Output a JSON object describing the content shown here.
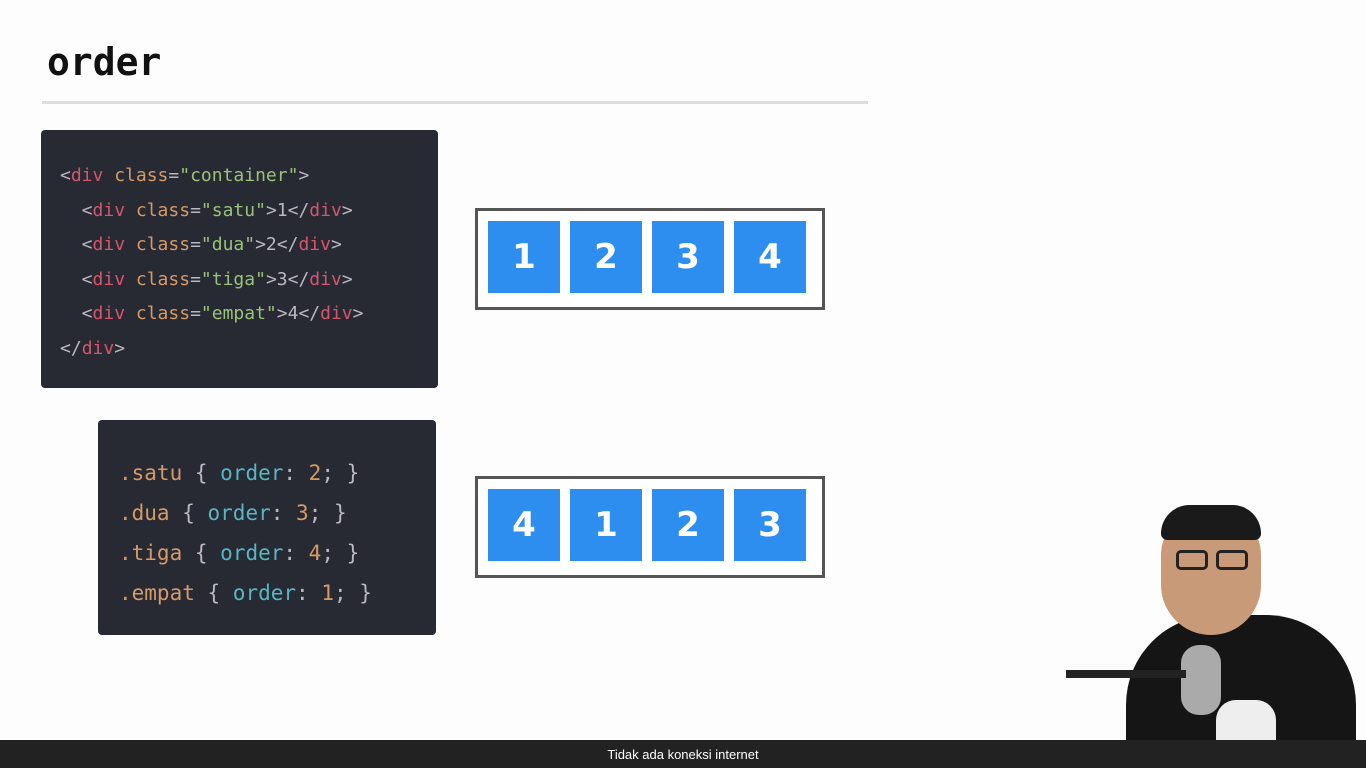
{
  "slide": {
    "title": "order",
    "html_code": [
      [
        {
          "t": "<",
          "c": "punct"
        },
        {
          "t": "div",
          "c": "tag"
        },
        {
          "t": " class",
          "c": "attr"
        },
        {
          "t": "=",
          "c": "punct"
        },
        {
          "t": "\"container\"",
          "c": "str"
        },
        {
          "t": ">",
          "c": "punct"
        }
      ],
      [
        {
          "t": "  <",
          "c": "punct"
        },
        {
          "t": "div",
          "c": "tag"
        },
        {
          "t": " class",
          "c": "attr"
        },
        {
          "t": "=",
          "c": "punct"
        },
        {
          "t": "\"satu\"",
          "c": "str"
        },
        {
          "t": ">1</",
          "c": "punct"
        },
        {
          "t": "div",
          "c": "tag"
        },
        {
          "t": ">",
          "c": "punct"
        }
      ],
      [
        {
          "t": "  <",
          "c": "punct"
        },
        {
          "t": "div",
          "c": "tag"
        },
        {
          "t": " class",
          "c": "attr"
        },
        {
          "t": "=",
          "c": "punct"
        },
        {
          "t": "\"dua\"",
          "c": "str"
        },
        {
          "t": ">2</",
          "c": "punct"
        },
        {
          "t": "div",
          "c": "tag"
        },
        {
          "t": ">",
          "c": "punct"
        }
      ],
      [
        {
          "t": "  <",
          "c": "punct"
        },
        {
          "t": "div",
          "c": "tag"
        },
        {
          "t": " class",
          "c": "attr"
        },
        {
          "t": "=",
          "c": "punct"
        },
        {
          "t": "\"tiga\"",
          "c": "str"
        },
        {
          "t": ">3</",
          "c": "punct"
        },
        {
          "t": "div",
          "c": "tag"
        },
        {
          "t": ">",
          "c": "punct"
        }
      ],
      [
        {
          "t": "  <",
          "c": "punct"
        },
        {
          "t": "div",
          "c": "tag"
        },
        {
          "t": " class",
          "c": "attr"
        },
        {
          "t": "=",
          "c": "punct"
        },
        {
          "t": "\"empat\"",
          "c": "str"
        },
        {
          "t": ">4</",
          "c": "punct"
        },
        {
          "t": "div",
          "c": "tag"
        },
        {
          "t": ">",
          "c": "punct"
        }
      ],
      [
        {
          "t": "</",
          "c": "punct"
        },
        {
          "t": "div",
          "c": "tag"
        },
        {
          "t": ">",
          "c": "punct"
        }
      ]
    ],
    "css_code": [
      [
        {
          "t": ".satu",
          "c": "sel"
        },
        {
          "t": " { ",
          "c": "punct"
        },
        {
          "t": "order",
          "c": "prop"
        },
        {
          "t": ": ",
          "c": "punct"
        },
        {
          "t": "2",
          "c": "num"
        },
        {
          "t": "; }",
          "c": "punct"
        }
      ],
      [
        {
          "t": ".dua",
          "c": "sel"
        },
        {
          "t": " { ",
          "c": "punct"
        },
        {
          "t": "order",
          "c": "prop"
        },
        {
          "t": ": ",
          "c": "punct"
        },
        {
          "t": "3",
          "c": "num"
        },
        {
          "t": "; }",
          "c": "punct"
        }
      ],
      [
        {
          "t": ".tiga",
          "c": "sel"
        },
        {
          "t": " { ",
          "c": "punct"
        },
        {
          "t": "order",
          "c": "prop"
        },
        {
          "t": ": ",
          "c": "punct"
        },
        {
          "t": "4",
          "c": "num"
        },
        {
          "t": "; }",
          "c": "punct"
        }
      ],
      [
        {
          "t": ".empat",
          "c": "sel"
        },
        {
          "t": " { ",
          "c": "punct"
        },
        {
          "t": "order",
          "c": "prop"
        },
        {
          "t": ": ",
          "c": "punct"
        },
        {
          "t": "1",
          "c": "num"
        },
        {
          "t": "; }",
          "c": "punct"
        }
      ]
    ],
    "flex_before": [
      "1",
      "2",
      "3",
      "4"
    ],
    "flex_after": [
      "4",
      "1",
      "2",
      "3"
    ],
    "item_color": "#2e8ef0"
  },
  "status_bar": {
    "message": "Tidak ada koneksi internet"
  }
}
